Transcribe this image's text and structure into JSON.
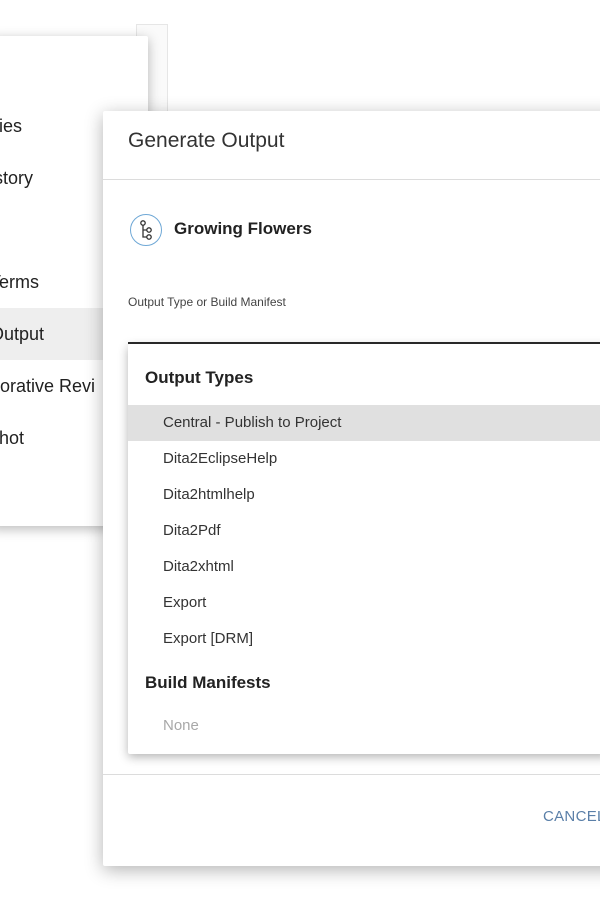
{
  "background_menu": {
    "items": [
      {
        "label": "cies",
        "active": false
      },
      {
        "label": "istory",
        "active": false
      },
      {
        "label": " Terms",
        "active": false
      },
      {
        "label": "Output",
        "active": true
      },
      {
        "label": "borative Revi",
        "active": false
      },
      {
        "label": "shot",
        "active": false
      }
    ]
  },
  "dialog": {
    "title": "Generate Output",
    "project_icon": "tree-branch-icon",
    "project_name": "Growing Flowers",
    "field_label": "Output Type or Build Manifest",
    "cancel_label": "CANCEL"
  },
  "dropdown": {
    "output_types_header": "Output Types",
    "output_types": [
      "Central - Publish to Project",
      "Dita2EclipseHelp",
      "Dita2htmlhelp",
      "Dita2Pdf",
      "Dita2xhtml",
      "Export",
      "Export [DRM]"
    ],
    "highlighted_index": 0,
    "build_manifests_header": "Build Manifests",
    "build_manifests_empty": "None"
  },
  "colors": {
    "accent": "#5a7fa8",
    "icon_ring": "#6fa8d6",
    "highlight": "#e0e0e0"
  }
}
